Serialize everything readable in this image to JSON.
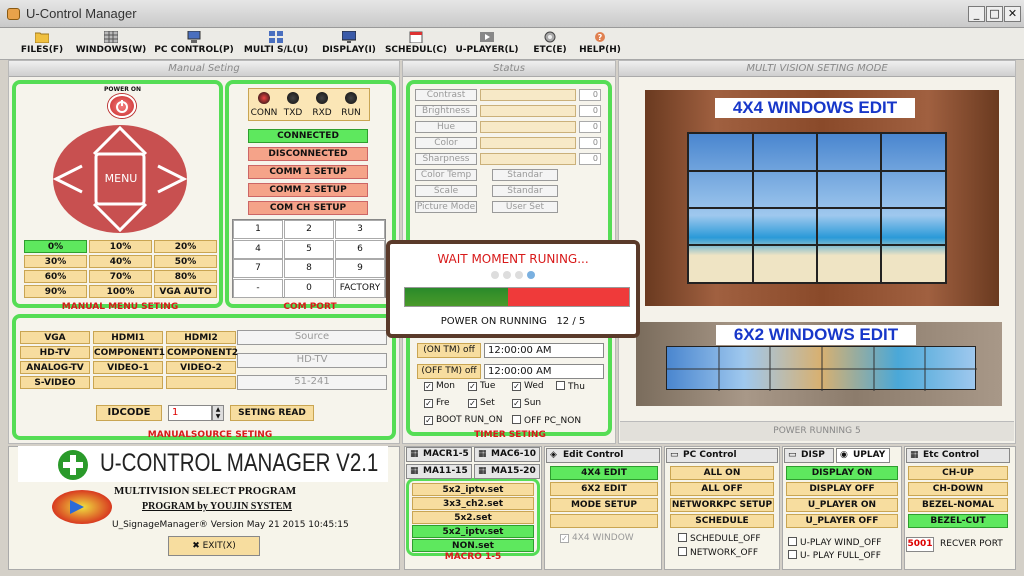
{
  "window": {
    "title": "U-Control Manager"
  },
  "menu": [
    {
      "label": "FILES(F)",
      "icon": "folder-icon"
    },
    {
      "label": "WINDOWS(W)",
      "icon": "grid-icon"
    },
    {
      "label": "PC CONTROL(P)",
      "icon": "computer-icon"
    },
    {
      "label": "MULTI S/L(U)",
      "icon": "monitor-wall-icon"
    },
    {
      "label": "DISPLAY(I)",
      "icon": "display-icon"
    },
    {
      "label": "SCHEDUL(C)",
      "icon": "calendar-icon"
    },
    {
      "label": "U-PLAYER(L)",
      "icon": "player-icon"
    },
    {
      "label": "ETC(E)",
      "icon": "gear-icon"
    },
    {
      "label": "HELP(H)",
      "icon": "help-icon"
    }
  ],
  "manual": {
    "header": "Manual Seting",
    "power_label": "POWER ON",
    "menu_label": "MENU",
    "levels": [
      "0%",
      "10%",
      "20%",
      "30%",
      "40%",
      "50%",
      "60%",
      "70%",
      "80%",
      "90%",
      "100%",
      "VGA AUTO"
    ],
    "menu_caption": "MANUAL MENU  SETING",
    "leds": [
      "CONN",
      "TXD",
      "RXD",
      "RUN"
    ],
    "com_buttons": [
      "CONNECTED",
      "DISCONNECTED",
      "COMM 1 SETUP",
      "COMM 2 SETUP",
      "COM CH  SETUP"
    ],
    "keypad": [
      "1",
      "2",
      "3",
      "4",
      "5",
      "6",
      "7",
      "8",
      "9",
      "-",
      "0",
      "FACTORY"
    ],
    "com_caption": "COM PORT",
    "sources": [
      "VGA",
      "HDMI1",
      "HDMI2",
      "HD-TV",
      "COMPONENT1",
      "COMPONENT2",
      "ANALOG-TV",
      "VIDEO-1",
      "VIDEO-2",
      "S-VIDEO",
      "",
      ""
    ],
    "source_boxes": [
      "Source",
      "HD-TV",
      "51-241"
    ],
    "idcode_label": "IDCODE",
    "idcode_value": "1",
    "seting_read": "SETING READ",
    "source_caption": "MANUALSOURCE SETING"
  },
  "status": {
    "header": "Status",
    "rows": [
      {
        "label": "Contrast",
        "value": "0"
      },
      {
        "label": "Brightness",
        "value": "0"
      },
      {
        "label": "Hue",
        "value": "0"
      },
      {
        "label": "Color",
        "value": "0"
      },
      {
        "label": "Sharpness",
        "value": "0"
      }
    ],
    "modes": [
      {
        "label": "Color Temp",
        "value": "Standar"
      },
      {
        "label": "Scale",
        "value": "Standar"
      },
      {
        "label": "Picture Mode",
        "value": "User Set"
      }
    ],
    "timer": {
      "on_label": "(ON  TM) off",
      "on_time": "12:00:00 AM",
      "off_label": "(OFF TM) off",
      "off_time": "12:00:00 AM",
      "days": [
        {
          "l": "Mon",
          "c": true
        },
        {
          "l": "Tue",
          "c": true
        },
        {
          "l": "Wed",
          "c": true
        },
        {
          "l": "Thu",
          "c": false
        },
        {
          "l": "Fre",
          "c": true
        },
        {
          "l": "Set",
          "c": true
        },
        {
          "l": "Sun",
          "c": true
        }
      ],
      "boot_run": "BOOT RUN_ON",
      "off_pc": "OFF PC_NON",
      "caption": "TIMER SETING"
    }
  },
  "dialog": {
    "title": "WAIT MOMENT  RUNING...",
    "progress_green": 0.46,
    "status": "POWER ON RUNNING",
    "count": "12 / 5"
  },
  "multivision": {
    "header": "MULTI VISION SETING MODE",
    "edit4x4": "4X4 WINDOWS EDIT",
    "edit6x2": "6X2 WINDOWS EDIT",
    "power_running": "POWER RUNNING 5"
  },
  "logo": {
    "title": "U-CONTROL MANAGER V2.1",
    "subtitle": "MULTIVISION  SELECT PROGRAM",
    "company": "PROGRAM by YOUJIN SYSTEM",
    "version": "U_SignageManager® Version   May 21 2015 10:45:15",
    "exit": "EXIT(X)"
  },
  "macro": {
    "tabs": [
      "MACR1-5",
      "MAC6-10",
      "MA11-15",
      "MA15-20"
    ],
    "items": [
      "5x2_iptv.set",
      "3x3_ch2.set",
      "5x2.set",
      "5x2_iptv.set",
      "NON.set"
    ],
    "caption": "MACRO 1-5"
  },
  "edit_control": {
    "tab": "Edit Control",
    "buttons": [
      "4X4 EDIT",
      "6X2 EDIT",
      "MODE SETUP",
      ""
    ],
    "window_check": "4X4 WINDOW"
  },
  "pc_control": {
    "tab": "PC Control",
    "buttons": [
      "ALL   ON",
      "ALL   OFF",
      "NETWORKPC SETUP",
      "SCHEDULE"
    ],
    "checks": [
      "SCHEDULE_OFF",
      "NETWORK_OFF"
    ]
  },
  "disp": {
    "tabs": [
      "DISP",
      "UPLAY"
    ],
    "buttons": [
      "DISPLAY   ON",
      "DISPLAY   OFF",
      "U_PLAYER ON",
      "U_PLAYER OFF"
    ],
    "checks": [
      "U-PLAY WIND_OFF",
      "U- PLAY FULL_OFF"
    ]
  },
  "etc": {
    "tab": "Etc Control",
    "buttons": [
      "CH-UP",
      "CH-DOWN",
      "BEZEL-NOMAL",
      "BEZEL-CUT"
    ],
    "port": "5001",
    "port_label": "RECVER  PORT"
  }
}
